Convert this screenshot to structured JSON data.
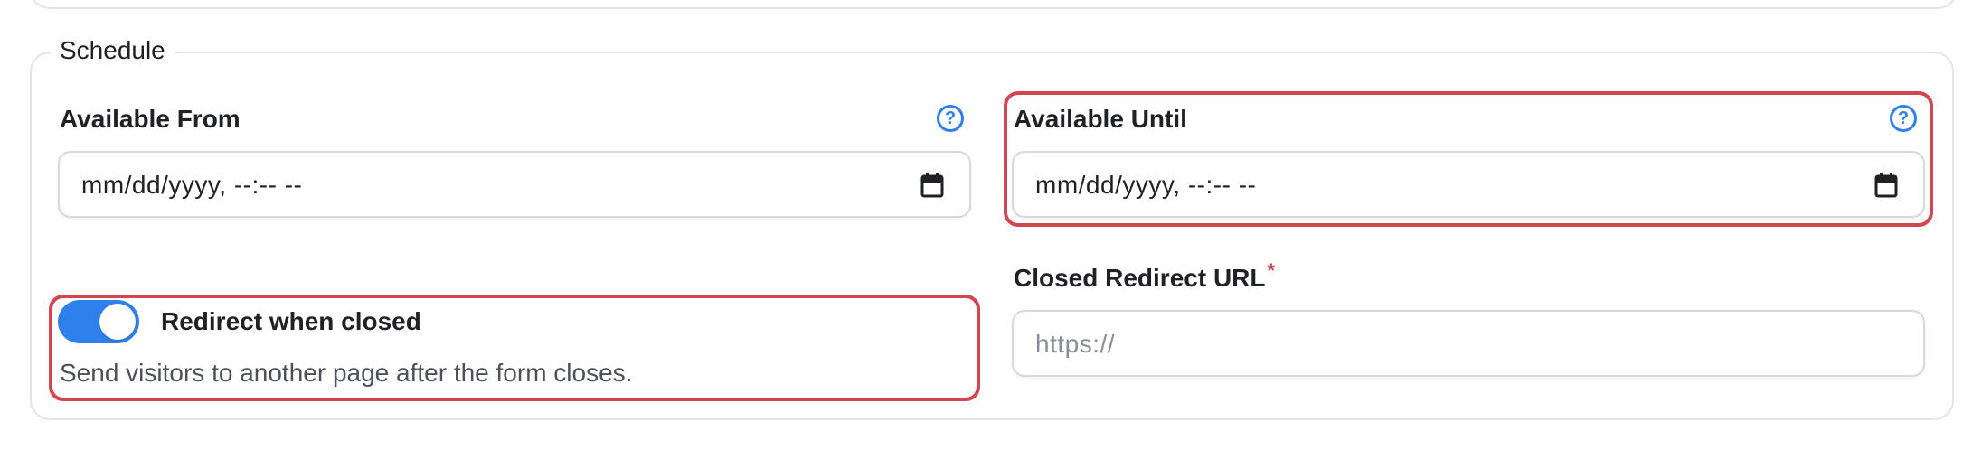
{
  "section": {
    "legend": "Schedule"
  },
  "available_from": {
    "label": "Available From",
    "value": "mm/dd/yyyy, --:-- --",
    "help_icon": "question-circle-icon",
    "calendar_icon": "calendar-icon"
  },
  "available_until": {
    "label": "Available Until",
    "value": "mm/dd/yyyy, --:-- --",
    "help_icon": "question-circle-icon",
    "calendar_icon": "calendar-icon"
  },
  "redirect_toggle": {
    "label": "Redirect when closed",
    "description": "Send visitors to another page after the form closes.",
    "checked": true
  },
  "closed_redirect_url": {
    "label": "Closed Redirect URL",
    "required_mark": "*",
    "placeholder": "https://"
  },
  "colors": {
    "accent": "#2f80ed",
    "highlight": "#d34550",
    "border": "#d6d8dc",
    "section_border": "#e3e4e7"
  }
}
